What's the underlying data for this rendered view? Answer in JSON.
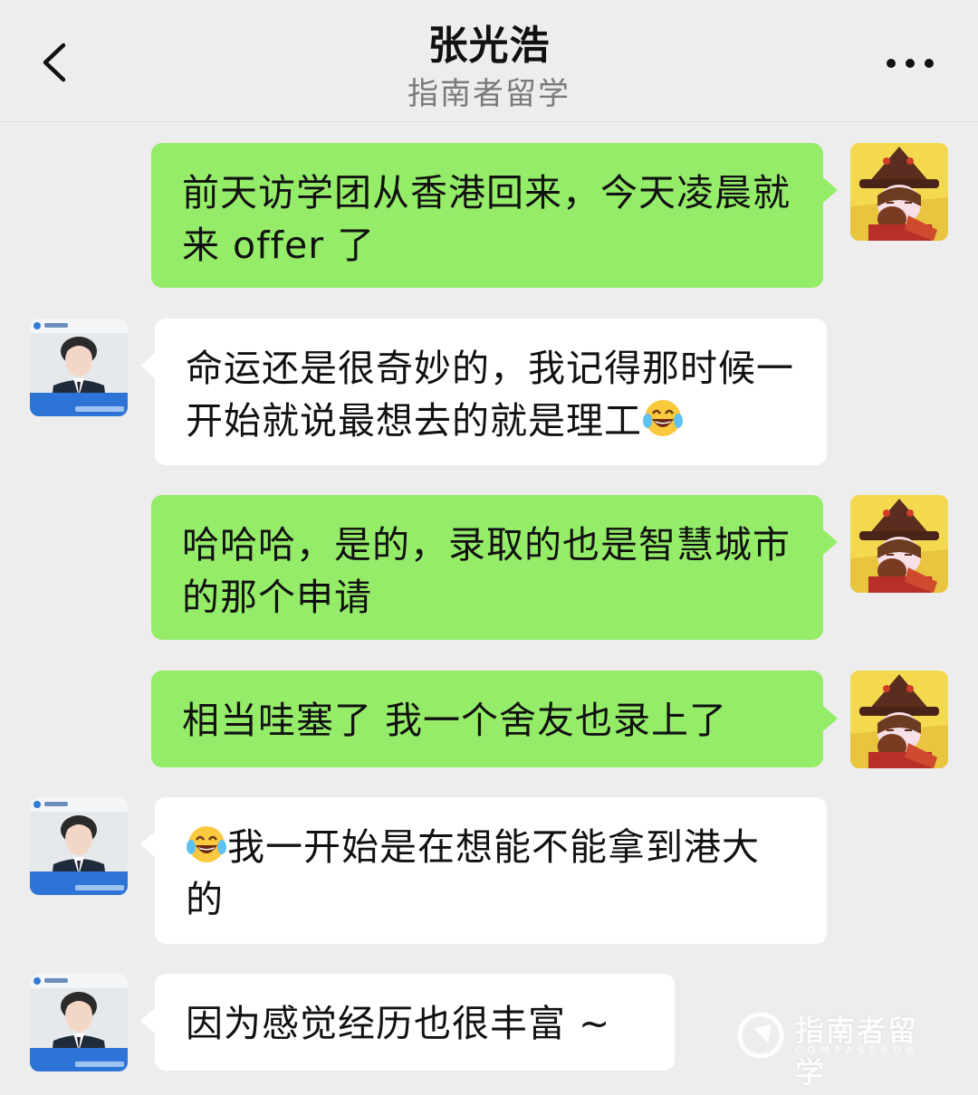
{
  "header": {
    "title": "张光浩",
    "subtitle": "指南者留学",
    "back_icon": "chevron-left-icon",
    "more_icon": "more-dots-icon"
  },
  "messages": [
    {
      "sender": "me",
      "text": "前天访学团从香港回来，今天凌晨就来 offer 了"
    },
    {
      "sender": "other",
      "text": "命运还是很奇妙的，我记得那时候一开始就说最想去的就是理工",
      "emoji": "laughing-tears-emoji"
    },
    {
      "sender": "me",
      "text": "哈哈哈，是的，录取的也是智慧城市的那个申请"
    },
    {
      "sender": "me",
      "text": "相当哇塞了 我一个舍友也录上了"
    },
    {
      "sender": "other",
      "text": "我一开始是在想能不能拿到港大的",
      "emoji": "laughing-tears-emoji"
    },
    {
      "sender": "other",
      "text": "因为感觉经历也很丰富 ~"
    }
  ],
  "avatar_other": {
    "badge_name": "张光浩",
    "logo_text": "指南者留学"
  },
  "watermark": {
    "text": "指南者留学",
    "sub": "COMPASSEDU"
  },
  "colors": {
    "background": "#ededed",
    "my_bubble": "#95ec69",
    "their_bubble": "#ffffff"
  }
}
